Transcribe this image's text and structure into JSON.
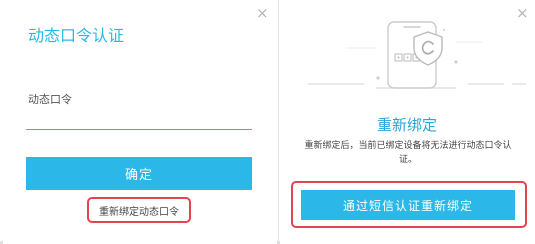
{
  "left_dialog": {
    "title": "动态口令认证",
    "input_placeholder": "动态口令",
    "confirm_label": "确定",
    "rebind_link_label": "重新绑定动态口令",
    "close_symbol": "×"
  },
  "right_dialog": {
    "title": "重新绑定",
    "description": "重新绑定后，当前已绑定设备将无法进行动态口令认证。",
    "sms_button_label": "通过短信认证重新绑定",
    "close_symbol": "×",
    "illustration_icon": "phone-shield-c-icon"
  },
  "colors": {
    "accent": "#2bb8e8",
    "title_blue": "#2aa4d6",
    "highlight_red": "#e24450",
    "close_gray": "#b5b5b5"
  }
}
